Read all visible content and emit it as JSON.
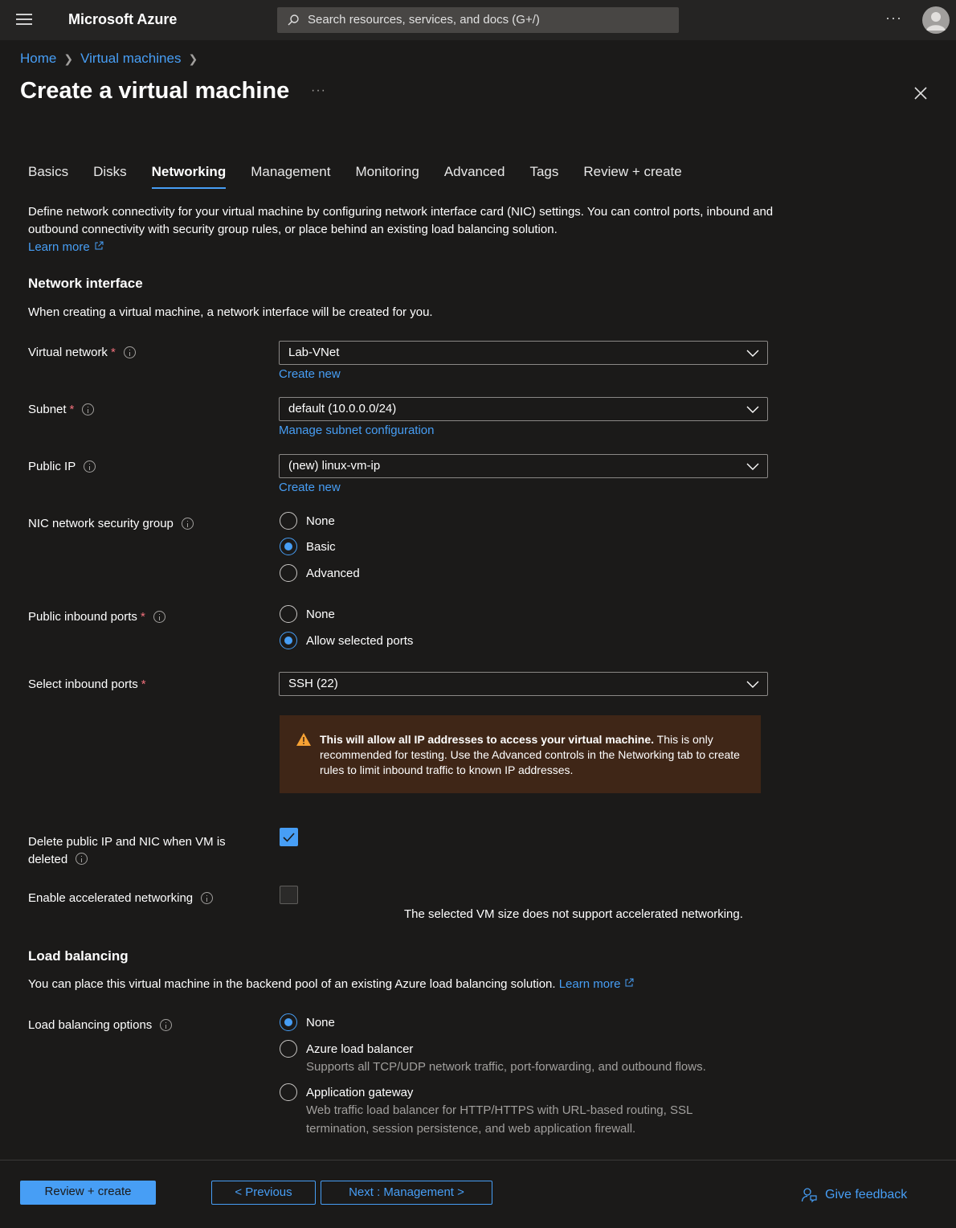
{
  "topbar": {
    "brand": "Microsoft Azure",
    "search_placeholder": "Search resources, services, and docs (G+/)",
    "more": "···"
  },
  "breadcrumb": {
    "items": [
      "Home",
      "Virtual machines"
    ]
  },
  "page": {
    "title": "Create a virtual machine",
    "more": "···"
  },
  "tabs": [
    "Basics",
    "Disks",
    "Networking",
    "Management",
    "Monitoring",
    "Advanced",
    "Tags",
    "Review + create"
  ],
  "active_tab": "Networking",
  "intro": {
    "text": "Define network connectivity for your virtual machine by configuring network interface card (NIC) settings. You can control ports, inbound and outbound connectivity with security group rules, or place behind an existing load balancing solution.",
    "learn_more": "Learn more"
  },
  "network_interface": {
    "title": "Network interface",
    "text": "When creating a virtual machine, a network interface will be created for you.",
    "virtual_network": {
      "label": "Virtual network",
      "required": "*",
      "value": "Lab-VNet",
      "link": "Create new"
    },
    "subnet": {
      "label": "Subnet",
      "required": "*",
      "value": "default (10.0.0.0/24)",
      "link": "Manage subnet configuration"
    },
    "public_ip": {
      "label": "Public IP",
      "value": "(new) linux-vm-ip",
      "link": "Create new"
    },
    "nsg": {
      "label": "NIC network security group",
      "options": [
        "None",
        "Basic",
        "Advanced"
      ],
      "selected": "Basic"
    },
    "inbound_ports": {
      "label": "Public inbound ports",
      "required": "*",
      "options": [
        "None",
        "Allow selected ports"
      ],
      "selected": "Allow selected ports"
    },
    "select_ports": {
      "label": "Select inbound ports",
      "required": "*",
      "value": "SSH (22)"
    },
    "warning": {
      "bold": "This will allow all IP addresses to access your virtual machine.",
      "text": " This is only recommended for testing.  Use the Advanced controls in the Networking tab to create rules to limit inbound traffic to known IP addresses."
    },
    "delete_public_ip": {
      "label_line1": "Delete public IP and NIC when VM is",
      "label_line2": "deleted",
      "checked": true
    },
    "accelerated": {
      "label": "Enable accelerated networking",
      "checked": false,
      "note": "The selected VM size does not support accelerated networking."
    }
  },
  "load_balancing": {
    "title": "Load balancing",
    "text": "You can place this virtual machine in the backend pool of an existing Azure load balancing solution.",
    "learn_more": "Learn more",
    "options_label": "Load balancing options",
    "options": [
      {
        "label": "None",
        "sub": ""
      },
      {
        "label": "Azure load balancer",
        "sub": "Supports all TCP/UDP network traffic, port-forwarding, and outbound flows."
      },
      {
        "label": "Application gateway",
        "sub1": "Web traffic load balancer for HTTP/HTTPS with URL-based routing, SSL",
        "sub2": "termination, session persistence, and web application firewall."
      }
    ],
    "selected": "None"
  },
  "footer": {
    "review_create": "Review + create",
    "previous": "< Previous",
    "next": "Next : Management >",
    "feedback": "Give feedback"
  },
  "colors": {
    "accent": "#479ef5",
    "background": "#1b1a19",
    "warning_bg": "#3f2617",
    "required": "#f1707b"
  }
}
